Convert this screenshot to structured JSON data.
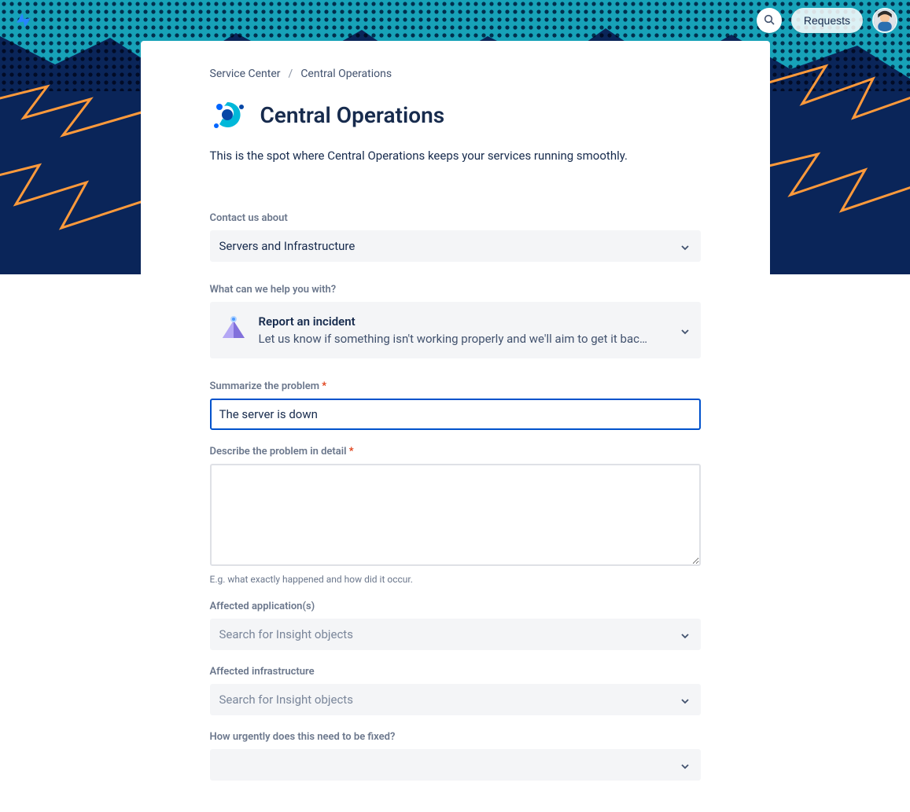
{
  "header": {
    "requests_label": "Requests"
  },
  "breadcrumb": {
    "parent": "Service Center",
    "current": "Central Operations"
  },
  "page": {
    "title": "Central Operations",
    "description": "This is the spot where Central Operations keeps your services running smoothly."
  },
  "form": {
    "contact": {
      "label": "Contact us about",
      "value": "Servers and Infrastructure"
    },
    "help": {
      "label": "What can we help you with?",
      "option_title": "Report an incident",
      "option_desc": "Let us know if something isn't working properly and we'll aim to get it bac…"
    },
    "summarize": {
      "label": "Summarize the problem",
      "value": "The server is down"
    },
    "describe": {
      "label": "Describe the problem in detail",
      "value": "",
      "hint": "E.g. what exactly happened and how did it occur."
    },
    "apps": {
      "label": "Affected application(s)",
      "placeholder": "Search for Insight objects"
    },
    "infra": {
      "label": "Affected infrastructure",
      "placeholder": "Search for Insight objects"
    },
    "urgency": {
      "label": "How urgently does this need to be fixed?",
      "value": ""
    }
  }
}
